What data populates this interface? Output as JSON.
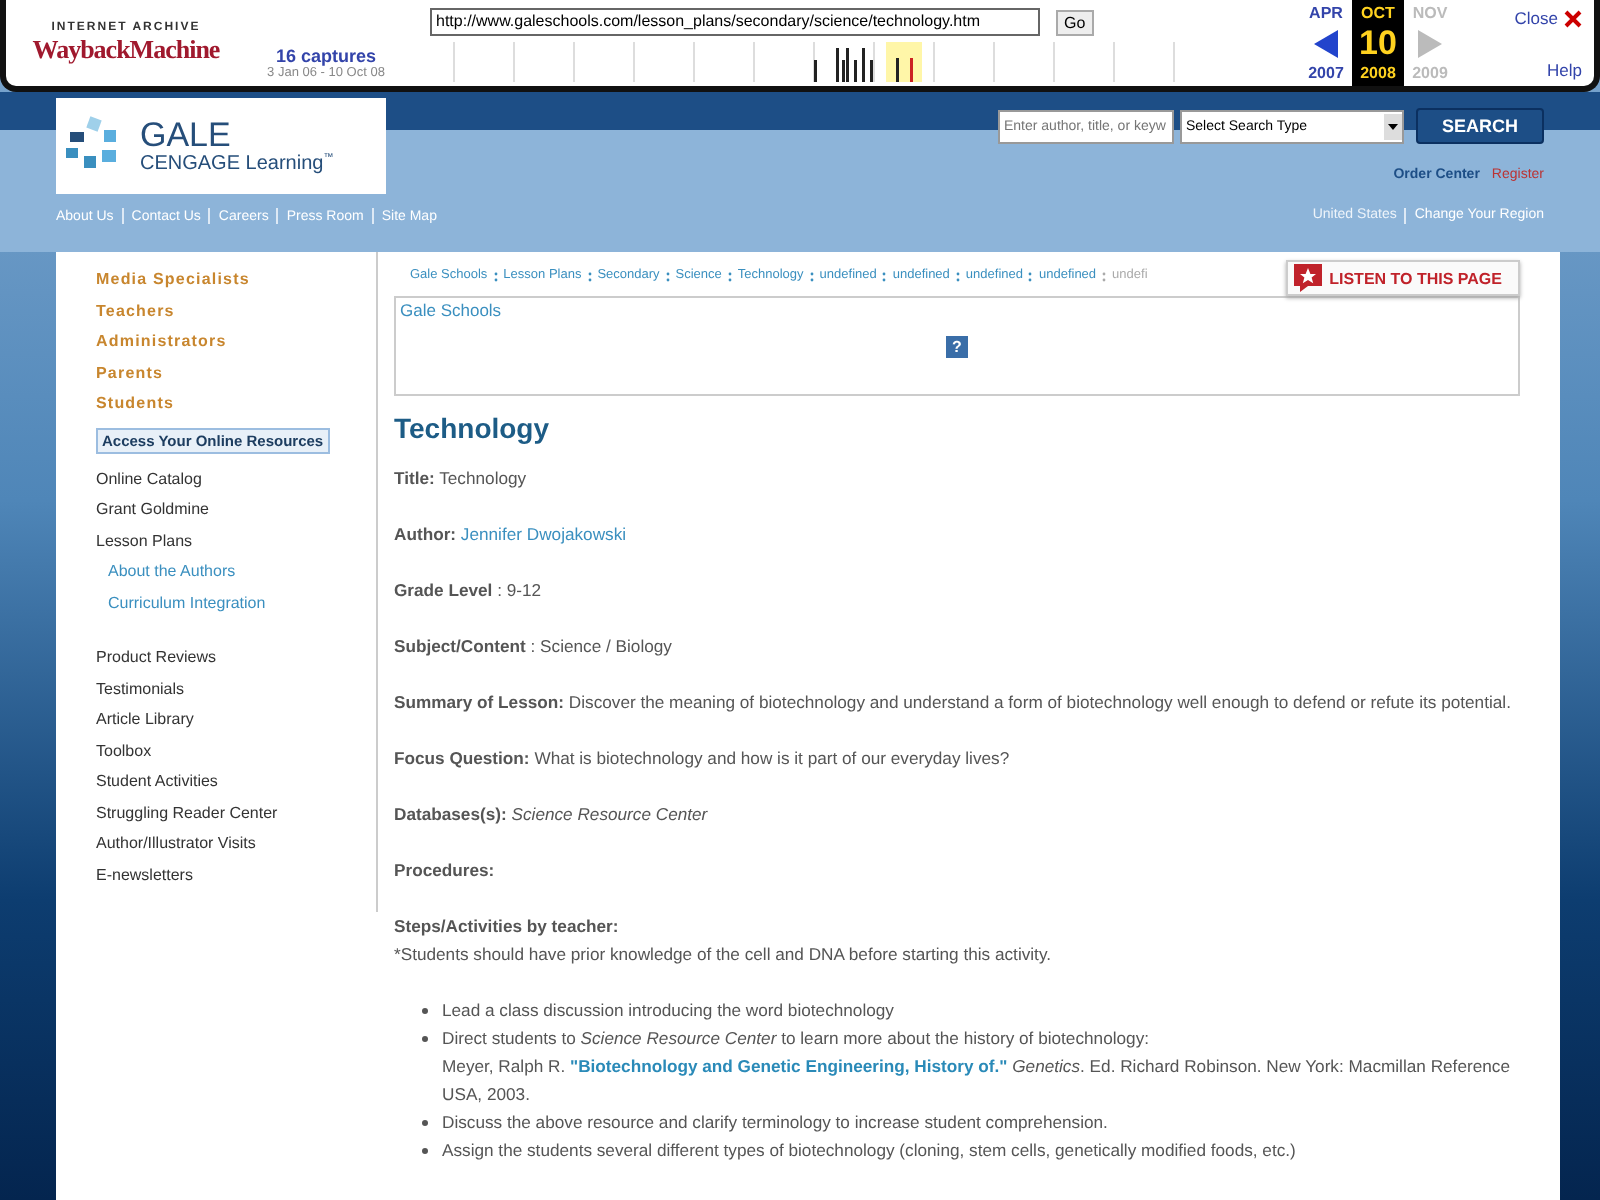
{
  "wayback": {
    "brand_top": "INTERNET ARCHIVE",
    "brand": "WaybackMachine",
    "url": "http://www.galeschools.com/lesson_plans/secondary/science/technology.htm",
    "go": "Go",
    "captures": "16 captures",
    "capture_range": "3 Jan 06 - 10 Oct 08",
    "months": [
      {
        "month": "APR",
        "year": "2007",
        "selected": false,
        "disabled": false
      },
      {
        "month": "OCT",
        "day": "10",
        "year": "2008",
        "selected": true,
        "disabled": false
      },
      {
        "month": "NOV",
        "year": "2009",
        "selected": false,
        "disabled": true
      }
    ],
    "close": "Close",
    "help": "Help"
  },
  "header": {
    "logo_top": "GALE",
    "logo_bottom": "CENGAGE Learning",
    "logo_tm": "™",
    "search_placeholder": "Enter author, title, or keyw",
    "search_type": "Select Search Type",
    "search_button": "SEARCH",
    "order_center": "Order Center",
    "register": "Register",
    "nav": [
      "About Us",
      "Contact Us",
      "Careers",
      "Press Room",
      "Site Map"
    ],
    "region_current": "United States",
    "region_change": "Change Your Region"
  },
  "sidebar": {
    "audiences": [
      "Media Specialists",
      "Teachers",
      "Administrators",
      "Parents",
      "Students"
    ],
    "access_button": "Access Your Online Resources",
    "groups": [
      [
        {
          "label": "Online Catalog"
        },
        {
          "label": "Grant Goldmine"
        },
        {
          "label": "Lesson Plans",
          "children": [
            {
              "label": "About the Authors"
            },
            {
              "label": "Curriculum Integration"
            }
          ]
        }
      ],
      [
        {
          "label": "Product Reviews"
        },
        {
          "label": "Testimonials"
        },
        {
          "label": "Article Library"
        },
        {
          "label": "Toolbox"
        },
        {
          "label": "Student Activities"
        },
        {
          "label": "Struggling Reader Center"
        },
        {
          "label": "Author/Illustrator Visits"
        },
        {
          "label": "E-newsletters"
        }
      ]
    ]
  },
  "main": {
    "breadcrumb": [
      "Gale Schools",
      "Lesson Plans",
      "Secondary",
      "Science",
      "Technology",
      "undefined",
      "undefined",
      "undefined",
      "undefined",
      "undefi"
    ],
    "listen_button": "LISTEN TO THIS PAGE",
    "box_link": "Gale Schools",
    "box_icon": "?",
    "heading": "Technology",
    "fields": [
      {
        "label": "Title:",
        "value": "Technology",
        "kind": "plain"
      },
      {
        "label": "Author:",
        "value": "Jennifer Dwojakowski",
        "kind": "link"
      },
      {
        "label": "Grade Level",
        "value": ": 9-12",
        "kind": "plain"
      },
      {
        "label": "Subject/Content",
        "value": ": Science / Biology",
        "kind": "plain"
      },
      {
        "label": "Summary of Lesson:",
        "value": "Discover the meaning of biotechnology and understand a form of biotechnology well enough to defend or refute its potential.",
        "kind": "plain"
      },
      {
        "label": "Focus Question:",
        "value": "What is biotechnology and how is it part of our everyday lives?",
        "kind": "plain"
      },
      {
        "label": "Databases(s):",
        "value": "Science Resource Center",
        "kind": "italic"
      },
      {
        "label": "Procedures:"
      }
    ],
    "steps_label": "Steps/Activities by teacher:",
    "steps_note": "*Students should have prior knowledge of the cell and DNA before starting this activity.",
    "bullets": [
      {
        "text": "Lead a class discussion introducing the word biotechnology"
      },
      {
        "text": "Direct students to *Science Resource Center* to learn more about the history of biotechnology:",
        "citation": "Meyer, Ralph R. **\"Biotechnology and Genetic Engineering, History of.\"** *Genetics*. Ed. Richard Robinson. New York: Macmillan Reference USA, 2003."
      },
      {
        "text": "Discuss the above resource and clarify terminology to increase student comprehension."
      },
      {
        "text": "Assign the students several different types of biotechnology (cloning, stem cells, genetically modified foods, etc.)"
      }
    ]
  }
}
